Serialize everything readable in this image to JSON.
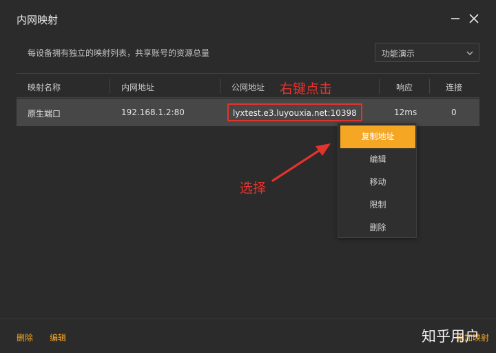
{
  "window": {
    "title": "内网映射",
    "minimize_icon": "minimize-icon",
    "close_icon": "close-icon"
  },
  "header": {
    "description": "每设备拥有独立的映射列表，共享账号的资源总量",
    "dropdown": {
      "selected": "功能演示",
      "icon": "chevron-down-icon"
    }
  },
  "table": {
    "columns": [
      "映射名称",
      "内网地址",
      "公网地址",
      "响应",
      "连接"
    ],
    "rows": [
      {
        "name": "原生端口",
        "lan_address": "192.168.1.2:80",
        "public_address": "lyxtest.e3.luyouxia.net:10398",
        "latency": "12ms",
        "connections": "0"
      }
    ]
  },
  "annotations": {
    "right_click": "右键点击",
    "select": "选择",
    "color": "#e4332d"
  },
  "context_menu": {
    "items": [
      {
        "label": "复制地址",
        "active": true
      },
      {
        "label": "编辑",
        "active": false
      },
      {
        "label": "移动",
        "active": false
      },
      {
        "label": "限制",
        "active": false
      },
      {
        "label": "删除",
        "active": false
      }
    ],
    "accent": "#f5a623"
  },
  "footer": {
    "delete_label": "删除",
    "edit_label": "编辑",
    "right_label": "添加映射"
  },
  "watermark": "知乎用户"
}
